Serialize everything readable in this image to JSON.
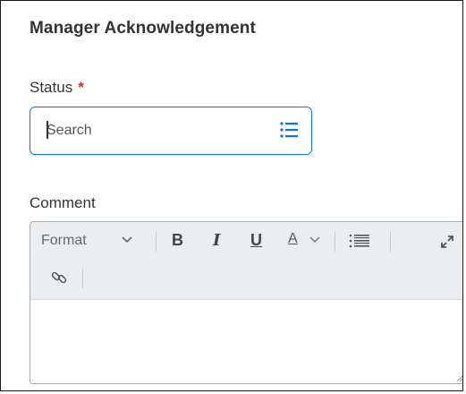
{
  "section": {
    "title": "Manager Acknowledgement"
  },
  "status_field": {
    "label": "Status",
    "required_marker": "*",
    "search_placeholder": "Search",
    "list_icon": "list-icon"
  },
  "comment_field": {
    "label": "Comment",
    "toolbar": {
      "format_label": "Format",
      "bold": "B",
      "italic": "I",
      "underline": "U",
      "font_color": "A",
      "icons": [
        "chevron-down-icon",
        "bulleted-list-icon",
        "expand-icon",
        "link-icon"
      ]
    }
  },
  "colors": {
    "accent": "#0875e1",
    "required": "#d93025",
    "toolbar_bg": "#ebeef0",
    "text": "#333333"
  }
}
